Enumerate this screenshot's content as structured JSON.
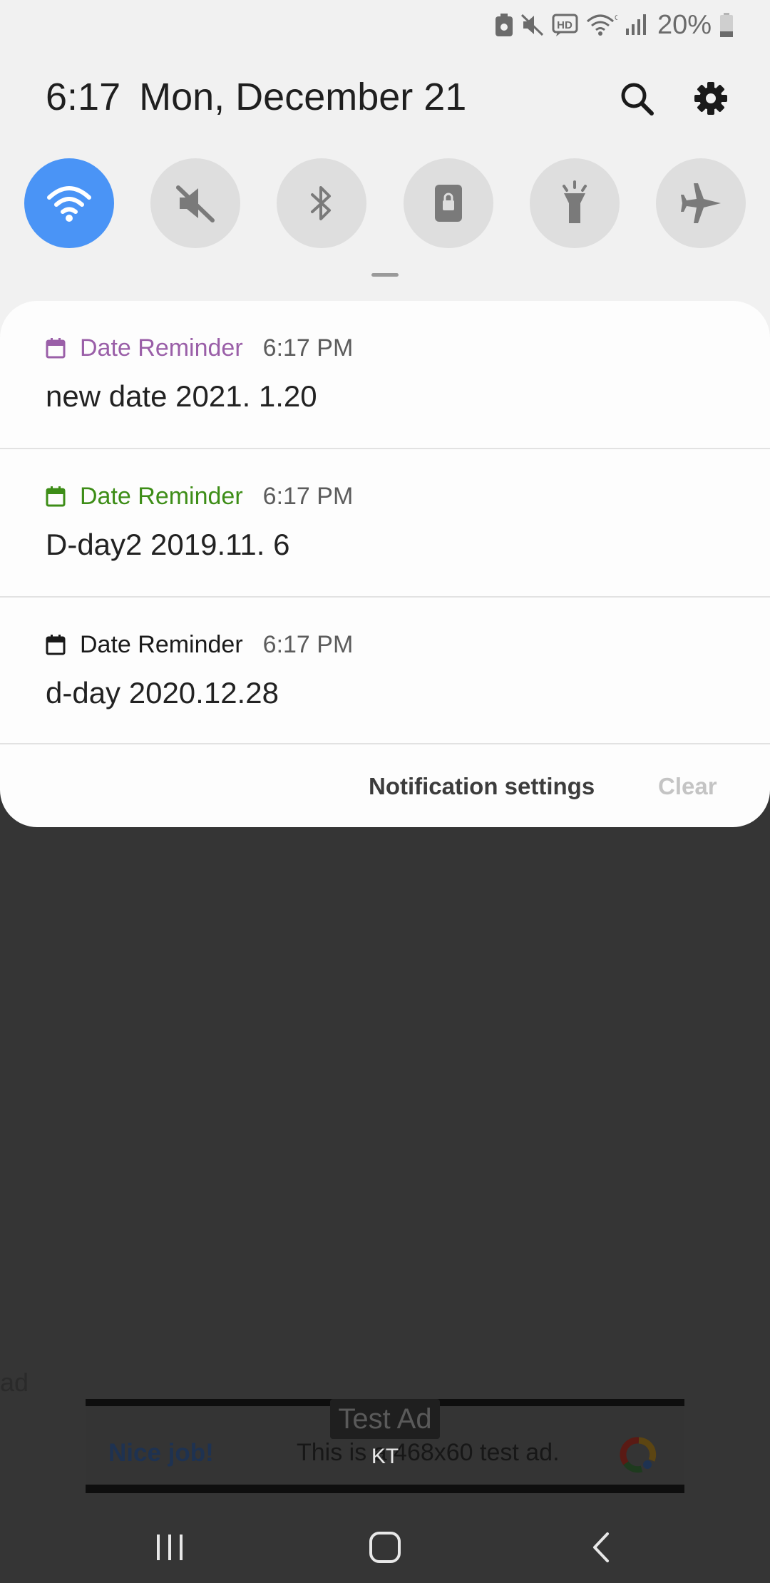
{
  "status_bar": {
    "icons": [
      "data-saver-icon",
      "mute-icon",
      "hd-voice-icon",
      "wifi-icon",
      "cell-signal-icon",
      "battery-icon"
    ],
    "battery_percent": "20%"
  },
  "header": {
    "time": "6:17",
    "date": "Mon, December 21"
  },
  "quick_toggles": [
    {
      "name": "wifi",
      "icon": "wifi-icon",
      "active": true
    },
    {
      "name": "sound",
      "icon": "mute-icon",
      "active": false
    },
    {
      "name": "bluetooth",
      "icon": "bluetooth-icon",
      "active": false
    },
    {
      "name": "portrait",
      "icon": "portrait-lock-icon",
      "active": false
    },
    {
      "name": "flashlight",
      "icon": "flashlight-icon",
      "active": false
    },
    {
      "name": "airplane",
      "icon": "airplane-icon",
      "active": false
    }
  ],
  "notifications": [
    {
      "app": "Date Reminder",
      "time": "6:17 PM",
      "title": "new date 2021. 1.20",
      "color": "#9a5fa8"
    },
    {
      "app": "Date Reminder",
      "time": "6:17 PM",
      "title": "D-day2 2019.11. 6",
      "color": "#3d8d17"
    },
    {
      "app": "Date Reminder",
      "time": "6:17 PM",
      "title": "d-day 2020.12.28",
      "color": "#1a1a1a"
    }
  ],
  "footer": {
    "settings_label": "Notification settings",
    "clear_label": "Clear"
  },
  "background": {
    "stray_text": "ad",
    "ad": {
      "nice": "Nice job!",
      "message": "This is a 468x60 test ad.",
      "badge": "Test Ad"
    },
    "carrier": "KT"
  },
  "nav_bar": [
    "recents-icon",
    "home-icon",
    "back-icon"
  ],
  "colors": {
    "accent": "#4a94f6",
    "panel_bg": "#f1f1f1",
    "card_bg": "#fdfdfd",
    "dim_bg": "#353535"
  }
}
